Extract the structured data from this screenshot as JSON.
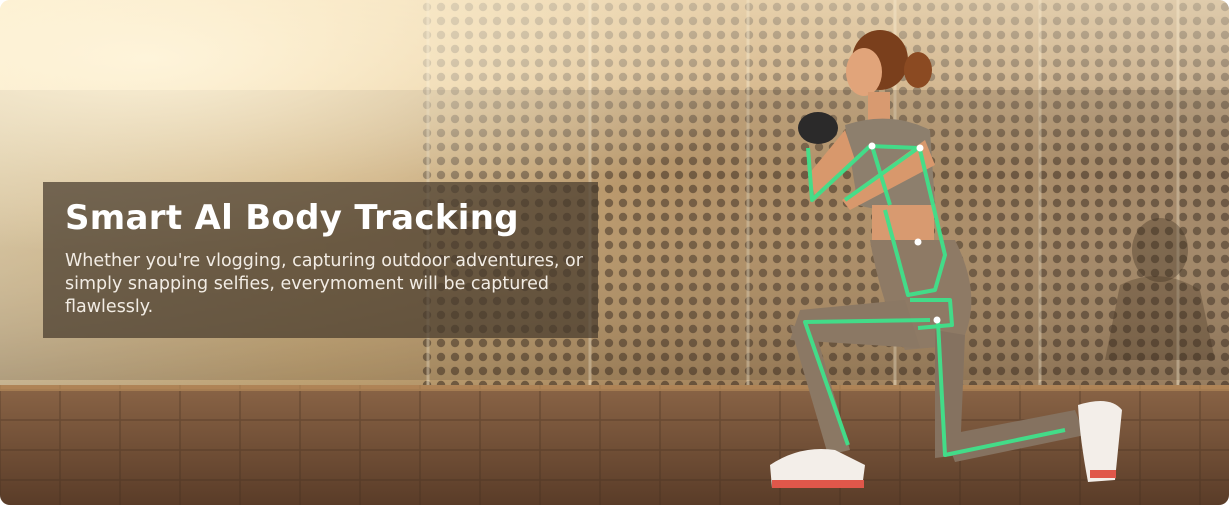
{
  "banner": {
    "title": "Smart Al Body Tracking",
    "description": "Whether you're vlogging, capturing outdoor adventures, or simply snapping selfies, everymoment will be captured flawlessly."
  },
  "colors": {
    "tracking_overlay": "#3fe08a",
    "caption_background": "#463a2c",
    "sky_glow": "#f4d6a0",
    "wall_tone": "#9b7f5e",
    "floor_tone": "#6b4c35"
  },
  "scene": {
    "image_subject": "woman-lunge-pose",
    "overlay_icon": "skeleton-tracking-lines"
  }
}
